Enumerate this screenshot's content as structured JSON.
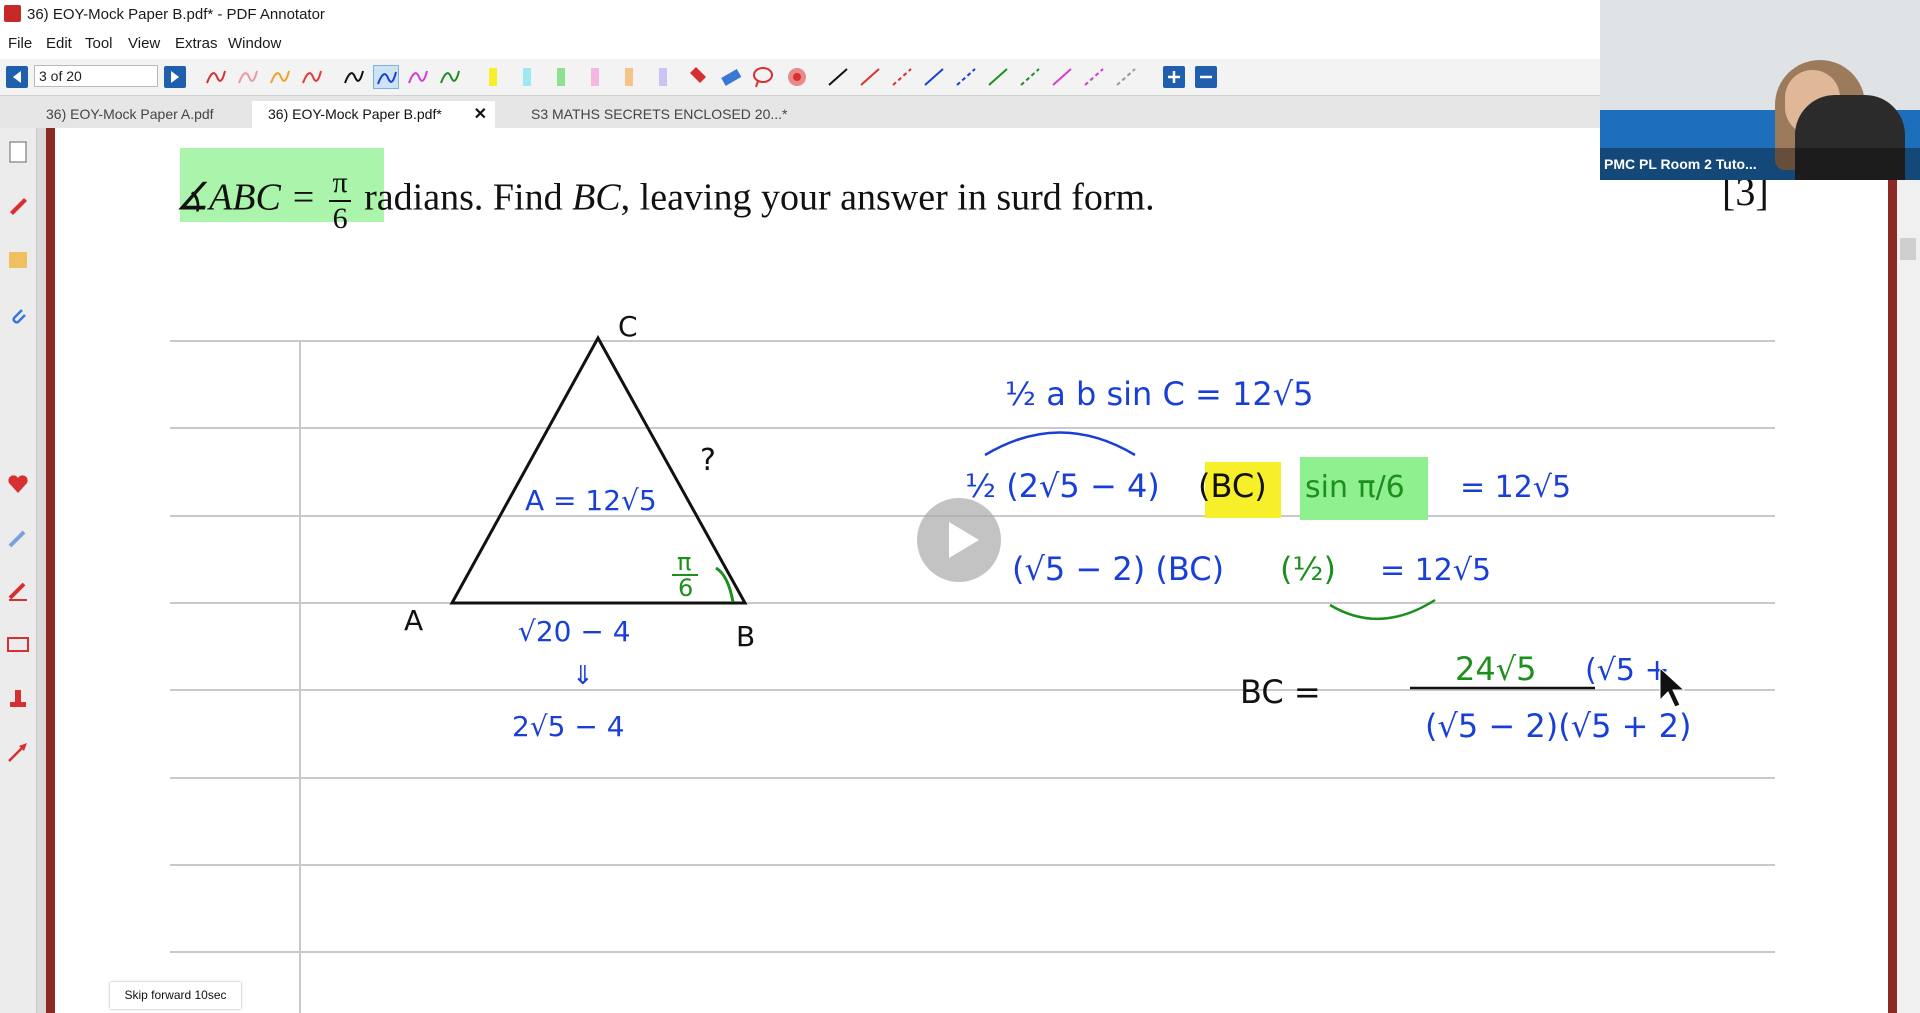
{
  "window": {
    "title": "36) EOY-Mock Paper B.pdf* - PDF Annotator"
  },
  "menu": [
    "File",
    "Edit",
    "Tool",
    "View",
    "Extras",
    "Window"
  ],
  "toolbar": {
    "page_indicator": "3 of 20"
  },
  "tabs": [
    {
      "label": "36) EOY-Mock Paper A.pdf"
    },
    {
      "label": "36) EOY-Mock Paper B.pdf*",
      "close": "✕"
    },
    {
      "label": "S3 MATHS SECRETS ENCLOSED 20...*"
    }
  ],
  "webcam": {
    "label": "PMC PL Room 2 Tuto..."
  },
  "tooltip": {
    "skip": "Skip forward 10sec"
  },
  "question": {
    "prefix": "∡ABC =",
    "pi": "π",
    "six": "6",
    "suffix": "radians. Find",
    "bc": "BC",
    "rest": ", leaving your answer in surd form.",
    "marks": "[3]"
  },
  "triangle": {
    "a": "A",
    "b": "B",
    "c": "C",
    "q": "?",
    "area": "A = 12√5",
    "angle_num": "π",
    "angle_den": "6",
    "base": "√20 − 4",
    "arrow": "⇓",
    "simplified": "2√5 − 4"
  },
  "working": {
    "line1": "½ a b sin C = 12√5",
    "line2a": "½ (2√5 − 4)",
    "line2b": "(BC)",
    "line2c": "sin π/6",
    "line2d": "= 12√5",
    "line3a": "(√5 − 2) (BC)",
    "line3b": "(½)",
    "line3c": "= 12√5",
    "bc_label": "BC =",
    "num": "24√5",
    "num_extra": "(√5 +",
    "den": "(√5 − 2)(√5 + 2)"
  },
  "colors": {
    "accent_red": "#8b2a25",
    "ink_blue": "#1a3fd6",
    "ink_green": "#1d8f1d",
    "highlight_green": "#8ff08f",
    "highlight_yellow": "#f6ef2a"
  }
}
